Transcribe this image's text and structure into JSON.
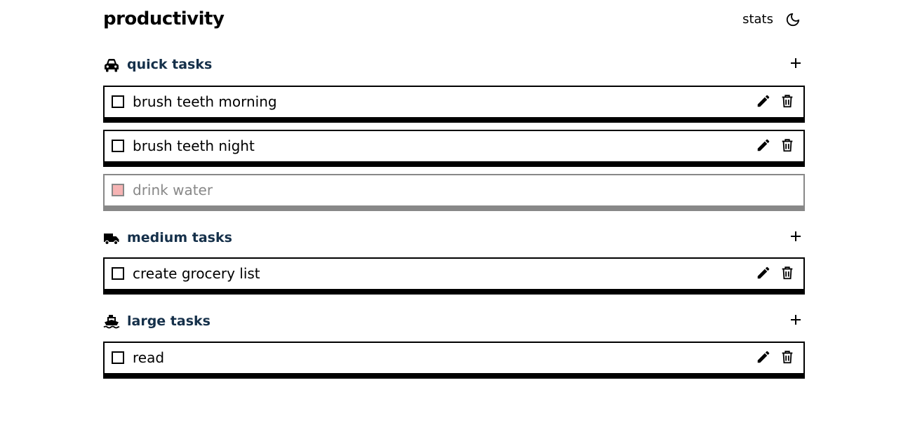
{
  "header": {
    "title": "productivity",
    "stats_label": "stats",
    "theme_icon": "moon-icon"
  },
  "sections": [
    {
      "title": "quick tasks",
      "icon": "car-icon",
      "tasks": [
        {
          "label": "brush teeth morning",
          "completed": false
        },
        {
          "label": "brush teeth night",
          "completed": false
        },
        {
          "label": "drink water",
          "completed": true
        }
      ]
    },
    {
      "title": "medium tasks",
      "icon": "truck-icon",
      "tasks": [
        {
          "label": "create grocery list",
          "completed": false
        }
      ]
    },
    {
      "title": "large tasks",
      "icon": "ship-icon",
      "tasks": [
        {
          "label": "read",
          "completed": false
        }
      ]
    }
  ],
  "colors": {
    "section_title": "#15304a",
    "completed_checkbox": "#f6b4b4",
    "completed_text": "#888888"
  }
}
